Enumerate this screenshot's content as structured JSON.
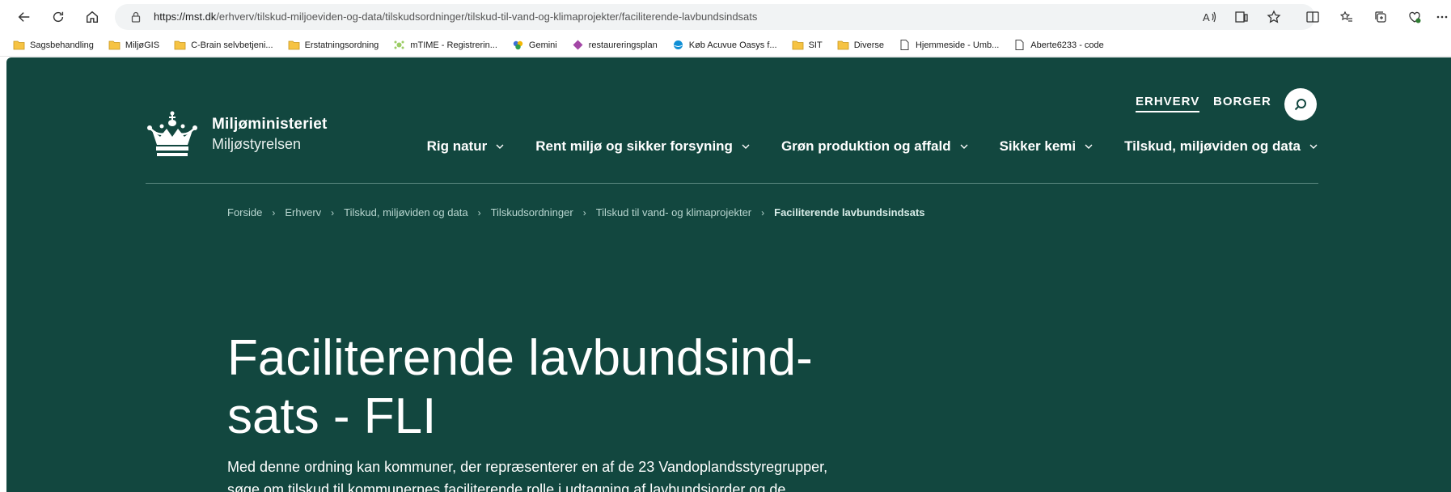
{
  "browser": {
    "url_host": "https://mst.dk",
    "url_path": "/erhverv/tilskud-miljoeviden-og-data/tilskudsordninger/tilskud-til-vand-og-klimaprojekter/faciliterende-lavbundsindsats"
  },
  "bookmarks": [
    {
      "label": "Sagsbehandling",
      "icon": "folder-icon"
    },
    {
      "label": "MiljøGIS",
      "icon": "folder-icon"
    },
    {
      "label": "C-Brain selvbetjeni...",
      "icon": "folder-icon"
    },
    {
      "label": "Erstatningsordning",
      "icon": "folder-icon"
    },
    {
      "label": "mTIME - Registrerin...",
      "icon": "mtime-icon"
    },
    {
      "label": "Gemini",
      "icon": "gemini-icon"
    },
    {
      "label": "restaureringsplan",
      "icon": "diamond-icon"
    },
    {
      "label": "Køb Acuvue Oasys f...",
      "icon": "globe-icon"
    },
    {
      "label": "SIT",
      "icon": "folder-icon"
    },
    {
      "label": "Diverse",
      "icon": "folder-icon"
    },
    {
      "label": "Hjemmeside - Umb...",
      "icon": "page-icon"
    },
    {
      "label": "Aberte6233 - code",
      "icon": "page-icon"
    }
  ],
  "header": {
    "ministry": "Miljøministeriet",
    "agency": "Miljøstyrelsen",
    "audience_erhverv": "ERHVERV",
    "audience_borger": "BORGER",
    "nav": [
      "Rig natur",
      "Rent miljø og sikker forsyning",
      "Grøn produktion og affald",
      "Sikker kemi",
      "Tilskud, miljøviden og data"
    ]
  },
  "breadcrumb": [
    "Forside",
    "Erhverv",
    "Tilskud, miljøviden og data",
    "Tilskudsordninger",
    "Tilskud til vand- og klimaprojekter",
    "Faciliterende lavbundsindsats"
  ],
  "main": {
    "title_line1": "Faciliterende lavbundsind-",
    "title_line2": "sats - FLI",
    "intro_line1": "Med denne ordning kan kommuner, der repræsenterer en af de 23 Vandoplandsstyregrupper,",
    "intro_line2": "søge om tilskud til kommunernes faciliterende rolle i udtagning af lavbundsjorder og de"
  },
  "colors": {
    "page_bg": "#12473f",
    "breadcrumb": "#b9d6d0"
  }
}
